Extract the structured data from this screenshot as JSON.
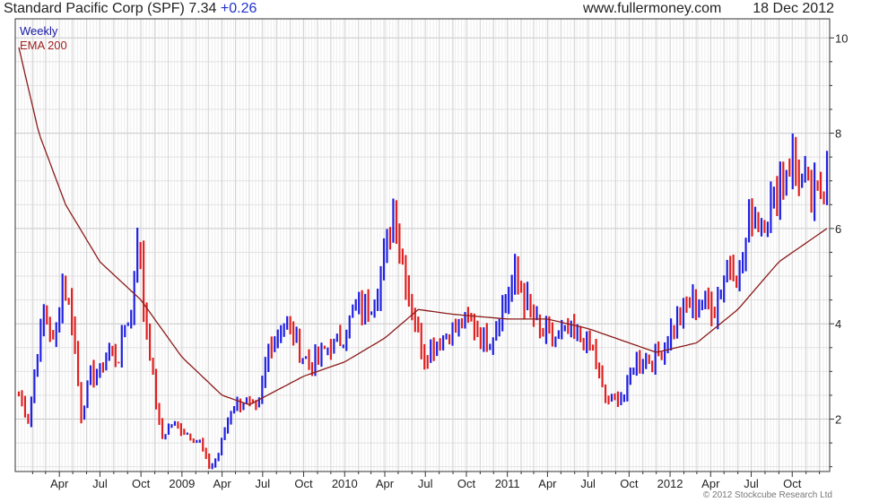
{
  "header": {
    "title": "Standard Pacific Corp (SPF)",
    "last": "7.34",
    "change": "+0.26",
    "site": "www.fullermoney.com",
    "date": "18 Dec 2012"
  },
  "legend": {
    "period": "Weekly",
    "ema_label": "EMA 200"
  },
  "copyright": "© 2012 Stockcube Research Ltd",
  "colors": {
    "up": "#2020e0",
    "down": "#e02020",
    "ema": "#8b1a1a",
    "grid": "#d8d8d8"
  },
  "chart_data": {
    "type": "candlestick",
    "period": "weekly",
    "y_axis": {
      "side": "right",
      "min": 0.9,
      "max": 10.4,
      "ticks": [
        2,
        4,
        6,
        8,
        10
      ]
    },
    "x_tick_labels": [
      "Apr",
      "Jul",
      "Oct",
      "2009",
      "Apr",
      "Jul",
      "Oct",
      "2010",
      "Apr",
      "Jul",
      "Oct",
      "2011",
      "Apr",
      "Jul",
      "Oct",
      "2012",
      "Apr",
      "Jul",
      "Oct"
    ],
    "close_anchors": [
      [
        "2008-01-01",
        2.5
      ],
      [
        "2008-01-22",
        2.0
      ],
      [
        "2008-02-12",
        3.4
      ],
      [
        "2008-02-28",
        4.3
      ],
      [
        "2008-03-20",
        3.5
      ],
      [
        "2008-04-08",
        4.9
      ],
      [
        "2008-04-28",
        4.2
      ],
      [
        "2008-05-20",
        2.1
      ],
      [
        "2008-06-10",
        2.9
      ],
      [
        "2008-07-01",
        3.0
      ],
      [
        "2008-07-20",
        3.5
      ],
      [
        "2008-08-10",
        3.2
      ],
      [
        "2008-08-28",
        4.1
      ],
      [
        "2008-09-10",
        4.2
      ],
      [
        "2008-09-24",
        6.1
      ],
      [
        "2008-10-06",
        4.4
      ],
      [
        "2008-10-24",
        3.2
      ],
      [
        "2008-11-14",
        1.6
      ],
      [
        "2008-12-10",
        1.9
      ],
      [
        "2009-01-12",
        1.7
      ],
      [
        "2009-02-10",
        1.5
      ],
      [
        "2009-03-05",
        0.95
      ],
      [
        "2009-03-25",
        1.3
      ],
      [
        "2009-04-20",
        2.2
      ],
      [
        "2009-05-20",
        2.4
      ],
      [
        "2009-06-20",
        2.1
      ],
      [
        "2009-07-15",
        3.6
      ],
      [
        "2009-08-15",
        4.0
      ],
      [
        "2009-09-10",
        3.7
      ],
      [
        "2009-09-30",
        3.3
      ],
      [
        "2009-10-20",
        3.1
      ],
      [
        "2009-11-20",
        3.5
      ],
      [
        "2009-12-20",
        3.6
      ],
      [
        "2010-01-25",
        4.3
      ],
      [
        "2010-02-25",
        4.4
      ],
      [
        "2010-03-25",
        5.0
      ],
      [
        "2010-04-20",
        6.5
      ],
      [
        "2010-05-10",
        5.4
      ],
      [
        "2010-06-01",
        4.3
      ],
      [
        "2010-06-30",
        3.3
      ],
      [
        "2010-07-20",
        3.6
      ],
      [
        "2010-08-20",
        3.8
      ],
      [
        "2010-09-20",
        4.0
      ],
      [
        "2010-10-15",
        4.0
      ],
      [
        "2010-11-20",
        3.6
      ],
      [
        "2010-12-20",
        4.3
      ],
      [
        "2011-01-20",
        5.0
      ],
      [
        "2011-02-15",
        4.4
      ],
      [
        "2011-03-15",
        3.8
      ],
      [
        "2011-04-15",
        3.7
      ],
      [
        "2011-05-15",
        3.8
      ],
      [
        "2011-06-15",
        3.7
      ],
      [
        "2011-07-10",
        3.5
      ],
      [
        "2011-08-05",
        2.5
      ],
      [
        "2011-08-25",
        2.4
      ],
      [
        "2011-09-20",
        2.5
      ],
      [
        "2011-10-15",
        3.2
      ],
      [
        "2011-11-10",
        3.2
      ],
      [
        "2011-12-10",
        3.4
      ],
      [
        "2012-01-15",
        4.1
      ],
      [
        "2012-02-10",
        4.4
      ],
      [
        "2012-03-10",
        4.5
      ],
      [
        "2012-04-10",
        4.3
      ],
      [
        "2012-05-10",
        5.4
      ],
      [
        "2012-06-05",
        5.0
      ],
      [
        "2012-07-01",
        6.4
      ],
      [
        "2012-07-25",
        6.2
      ],
      [
        "2012-08-20",
        6.5
      ],
      [
        "2012-09-15",
        7.3
      ],
      [
        "2012-10-05",
        7.4
      ],
      [
        "2012-10-25",
        6.9
      ],
      [
        "2012-11-15",
        6.6
      ],
      [
        "2012-12-05",
        6.8
      ],
      [
        "2012-12-18",
        7.34
      ]
    ],
    "ema_200": [
      [
        "2008-01-01",
        9.8
      ],
      [
        "2008-02-15",
        8.0
      ],
      [
        "2008-04-15",
        6.5
      ],
      [
        "2008-07-01",
        5.3
      ],
      [
        "2008-10-01",
        4.5
      ],
      [
        "2009-01-01",
        3.3
      ],
      [
        "2009-04-01",
        2.5
      ],
      [
        "2009-06-01",
        2.3
      ],
      [
        "2009-08-01",
        2.6
      ],
      [
        "2009-10-01",
        2.9
      ],
      [
        "2010-01-01",
        3.2
      ],
      [
        "2010-04-01",
        3.7
      ],
      [
        "2010-06-15",
        4.3
      ],
      [
        "2010-09-01",
        4.2
      ],
      [
        "2011-01-01",
        4.1
      ],
      [
        "2011-04-01",
        4.1
      ],
      [
        "2011-07-01",
        3.9
      ],
      [
        "2011-10-01",
        3.6
      ],
      [
        "2011-12-01",
        3.4
      ],
      [
        "2012-03-01",
        3.6
      ],
      [
        "2012-06-01",
        4.3
      ],
      [
        "2012-09-01",
        5.3
      ],
      [
        "2012-12-18",
        6.0
      ]
    ]
  }
}
